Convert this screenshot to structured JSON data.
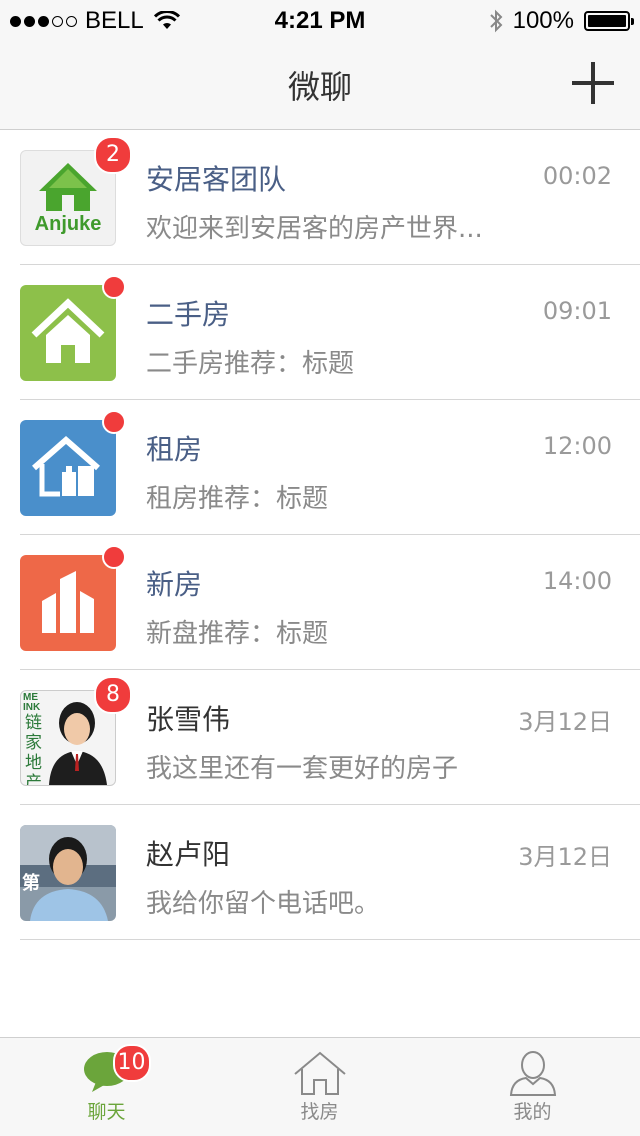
{
  "status_bar": {
    "carrier": "BELL",
    "time": "4:21 PM",
    "battery": "100%"
  },
  "nav": {
    "title": "微聊"
  },
  "chats": [
    {
      "name": "安居客团队",
      "message": "欢迎来到安居客的房产世界...",
      "time": "00:02",
      "badge": "2",
      "logo_text": "Anjuke"
    },
    {
      "name": "二手房",
      "message": "二手房推荐：标题",
      "time": "09:01"
    },
    {
      "name": "租房",
      "message": "租房推荐：标题",
      "time": "12:00"
    },
    {
      "name": "新房",
      "message": "新盘推荐：标题",
      "time": "14:00"
    },
    {
      "name": "张雪伟",
      "message": "我这里还有一套更好的房子",
      "time": "3月12日",
      "badge": "8",
      "photo_text": [
        "ME",
        "INK",
        "链",
        "家",
        "地",
        "产"
      ]
    },
    {
      "name": "赵卢阳",
      "message": "我给你留个电话吧。",
      "time": "3月12日",
      "photo_text": "第"
    }
  ],
  "tabs": [
    {
      "label": "聊天",
      "badge": "10"
    },
    {
      "label": "找房"
    },
    {
      "label": "我的"
    }
  ],
  "colors": {
    "accent_green": "#6ba53b",
    "badge_red": "#f03c3c",
    "second_hand_tile": "#8dc04a",
    "rent_tile": "#4a8fcb",
    "new_house_tile": "#ee6848",
    "name_blue": "#4a5f86"
  }
}
